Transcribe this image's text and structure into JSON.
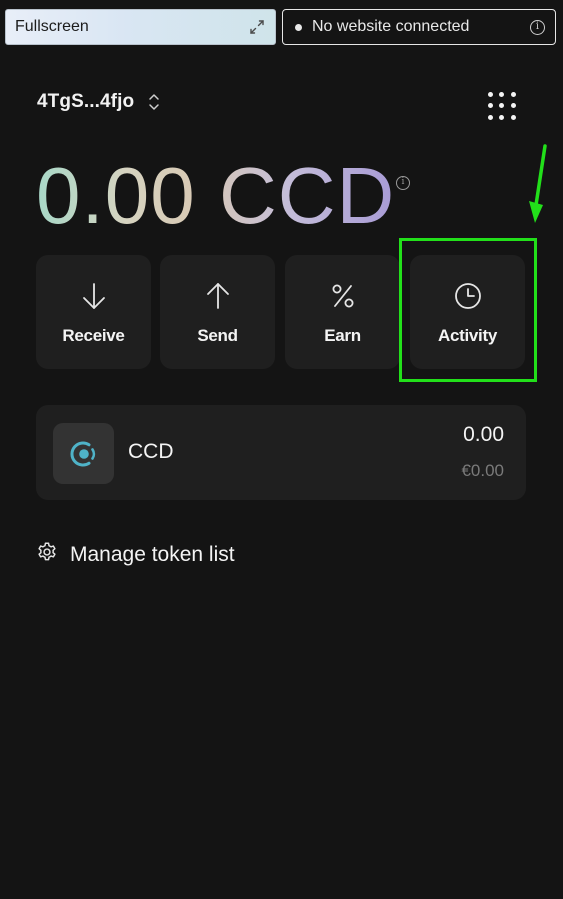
{
  "topbar": {
    "fullscreen_label": "Fullscreen",
    "expand_icon": "expand-arrows-icon",
    "connection_status": "No website connected",
    "connection_info_icon": "info-icon"
  },
  "account": {
    "name": "4TgS...4fjo",
    "switch_icon": "chevron-up-down-icon",
    "menu_icon": "dots-grid-icon"
  },
  "balance": {
    "amount": "0.00",
    "currency": "CCD",
    "info_icon": "info-icon"
  },
  "actions": [
    {
      "label": "Receive",
      "icon": "arrow-down-icon"
    },
    {
      "label": "Send",
      "icon": "arrow-up-icon"
    },
    {
      "label": "Earn",
      "icon": "percent-icon"
    },
    {
      "label": "Activity",
      "icon": "clock-icon"
    }
  ],
  "annotation": {
    "highlight_color": "#22e01a",
    "highlighted_item": "Activity"
  },
  "tokens": [
    {
      "name": "CCD",
      "amount": "0.00",
      "fiat": "€0.00",
      "icon": "ccd-token-icon",
      "accent": "#4fb3c8"
    }
  ],
  "manage_tokens": {
    "label": "Manage token list",
    "icon": "gear-icon"
  },
  "colors": {
    "background": "#141414",
    "card": "#1f1f1f",
    "muted_text": "#7a7a7a"
  }
}
